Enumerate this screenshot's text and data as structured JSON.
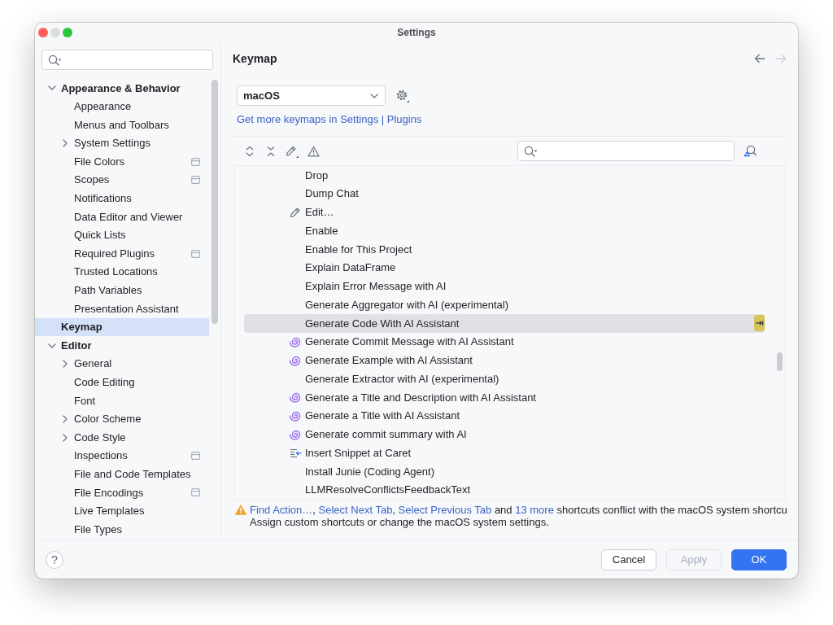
{
  "window": {
    "title": "Settings"
  },
  "title_bar": {
    "traffic_lights": [
      {
        "kind": "close",
        "disabled": false
      },
      {
        "kind": "minimize",
        "disabled": true
      },
      {
        "kind": "zoom",
        "disabled": false
      }
    ]
  },
  "sidebar": {
    "tree": [
      {
        "label": "Appearance & Behavior",
        "expanded": true,
        "selected": false,
        "children": [
          {
            "label": "Appearance",
            "selected": false
          },
          {
            "label": "Menus and Toolbars",
            "selected": false
          },
          {
            "label": "System Settings",
            "expanded": false,
            "selected": false
          },
          {
            "label": "File Colors",
            "selected": false,
            "project_level": true
          },
          {
            "label": "Scopes",
            "selected": false,
            "project_level": true
          },
          {
            "label": "Notifications",
            "selected": false
          },
          {
            "label": "Data Editor and Viewer",
            "selected": false
          },
          {
            "label": "Quick Lists",
            "selected": false
          },
          {
            "label": "Required Plugins",
            "selected": false,
            "project_level": true
          },
          {
            "label": "Trusted Locations",
            "selected": false
          },
          {
            "label": "Path Variables",
            "selected": false
          },
          {
            "label": "Presentation Assistant",
            "selected": false
          }
        ]
      },
      {
        "label": "Keymap",
        "selected": true
      },
      {
        "label": "Editor",
        "expanded": true,
        "selected": false,
        "children": [
          {
            "label": "General",
            "expanded": false,
            "selected": false
          },
          {
            "label": "Code Editing",
            "selected": false
          },
          {
            "label": "Font",
            "selected": false
          },
          {
            "label": "Color Scheme",
            "expanded": false,
            "selected": false
          },
          {
            "label": "Code Style",
            "expanded": false,
            "selected": false
          },
          {
            "label": "Inspections",
            "selected": false,
            "project_level": true
          },
          {
            "label": "File and Code Templates",
            "selected": false
          },
          {
            "label": "File Encodings",
            "selected": false,
            "project_level": true
          },
          {
            "label": "Live Templates",
            "selected": false
          },
          {
            "label": "File Types",
            "selected": false
          }
        ]
      }
    ]
  },
  "keymap": {
    "title": "Keymap",
    "nav": [
      {
        "kind": "back",
        "disabled": false
      },
      {
        "kind": "forward",
        "disabled": true
      }
    ],
    "scheme": {
      "value": "macOS"
    },
    "more_link": "Get more keymaps in Settings | Plugins",
    "actions": {
      "rows": [
        {
          "label": "Drop",
          "kind": "plain",
          "selected": false
        },
        {
          "label": "Dump Chat",
          "kind": "plain",
          "selected": false
        },
        {
          "label": "Edit…",
          "kind": "edit",
          "selected": false
        },
        {
          "label": "Enable",
          "kind": "plain",
          "selected": false
        },
        {
          "label": "Enable for This Project",
          "kind": "plain",
          "selected": false
        },
        {
          "label": "Explain DataFrame",
          "kind": "plain",
          "selected": false
        },
        {
          "label": "Explain Error Message with AI",
          "kind": "plain",
          "selected": false
        },
        {
          "label": "Generate Aggregator with AI (experimental)",
          "kind": "plain",
          "selected": false
        },
        {
          "label": "Generate Code With AI Assistant",
          "kind": "plain",
          "selected": true,
          "shortcut_marker": true
        },
        {
          "label": "Generate Commit Message with AI Assistant",
          "kind": "ai",
          "selected": false
        },
        {
          "label": "Generate Example with AI Assistant",
          "kind": "ai",
          "selected": false
        },
        {
          "label": "Generate Extractor with AI (experimental)",
          "kind": "plain",
          "selected": false
        },
        {
          "label": "Generate a Title and Description with AI Assistant",
          "kind": "ai",
          "selected": false
        },
        {
          "label": "Generate a Title with AI Assistant",
          "kind": "ai",
          "selected": false
        },
        {
          "label": "Generate commit summary with AI",
          "kind": "ai",
          "selected": false
        },
        {
          "label": "Insert Snippet at Caret",
          "kind": "snippet",
          "selected": false
        },
        {
          "label": "Install Junie (Coding Agent)",
          "kind": "plain",
          "selected": false
        },
        {
          "label": "LLMResolveConflictsFeedbackText",
          "kind": "plain",
          "selected": false
        }
      ]
    }
  },
  "conflict_warning": {
    "message": [
      {
        "kind": "link",
        "text": "Find Action…"
      },
      {
        "kind": "text",
        "text": ", "
      },
      {
        "kind": "link",
        "text": "Select Next Tab"
      },
      {
        "kind": "text",
        "text": ", "
      },
      {
        "kind": "link",
        "text": "Select Previous Tab"
      },
      {
        "kind": "text",
        "text": " and "
      },
      {
        "kind": "link",
        "text": "13 more"
      },
      {
        "kind": "text",
        "text": " shortcuts conflict with the macOS system shortcu"
      }
    ],
    "hint": "Assign custom shortcuts or change the macOS system settings."
  },
  "help_button": {
    "label": "?"
  },
  "buttons": [
    {
      "label": "Cancel",
      "kind": "secondary",
      "disabled": false
    },
    {
      "label": "Apply",
      "kind": "secondary",
      "disabled": true
    },
    {
      "label": "OK",
      "kind": "primary",
      "disabled": false
    }
  ]
}
